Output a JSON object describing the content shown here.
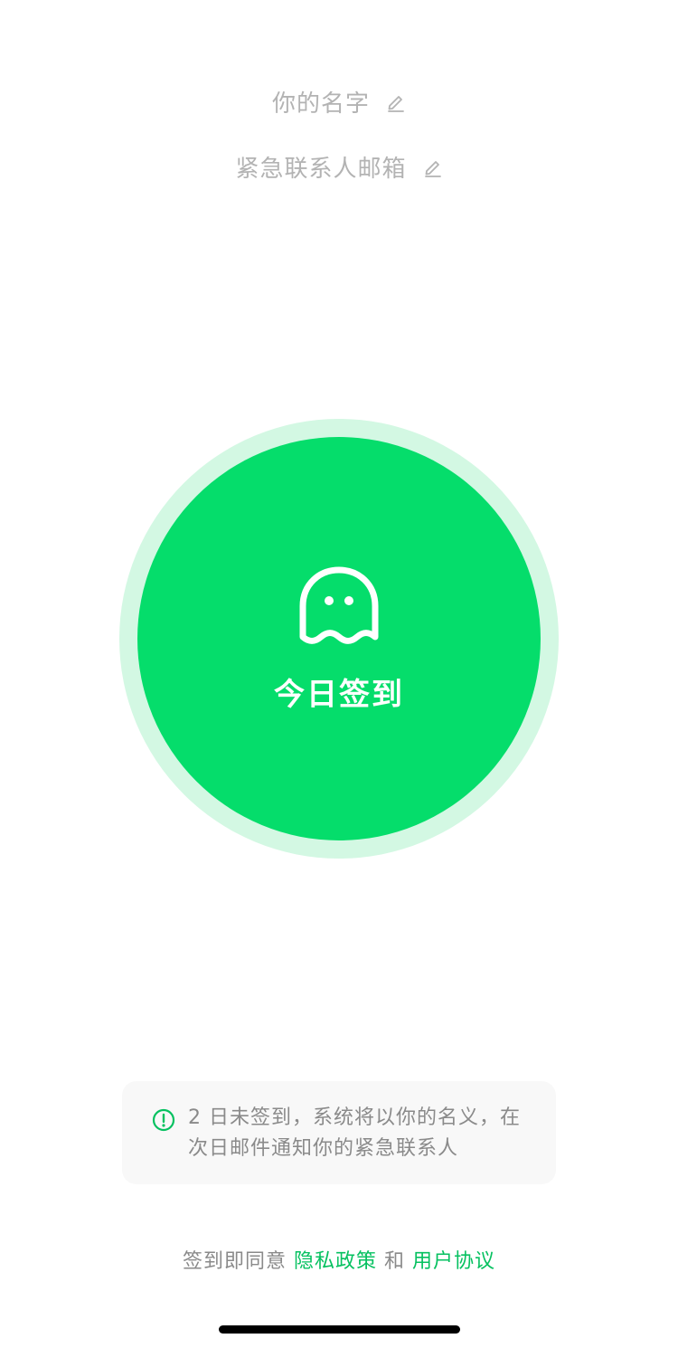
{
  "profile": {
    "name_placeholder": "你的名字",
    "email_placeholder": "紧急联系人邮箱",
    "edit_icon": "pencil-icon"
  },
  "checkin": {
    "label": "今日签到",
    "icon": "ghost-icon",
    "button_color": "#05dd6b",
    "ring_color": "#d3f8e3"
  },
  "notice": {
    "icon": "exclamation-circle-icon",
    "text": "2 日未签到，系统将以你的名义，在次日邮件通知你的紧急联系人"
  },
  "agreement": {
    "prefix": "签到即同意",
    "privacy_link": "隐私政策",
    "conjunction": "和",
    "terms_link": "用户协议",
    "link_color": "#06c160"
  }
}
